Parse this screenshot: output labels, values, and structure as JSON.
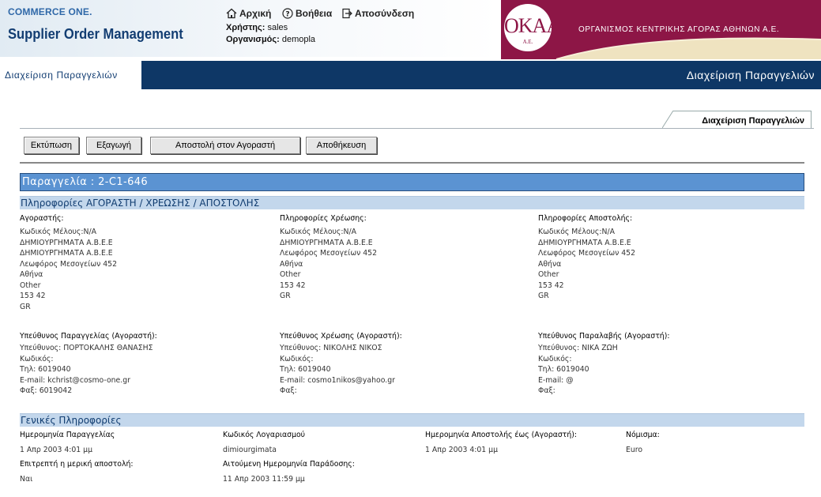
{
  "header": {
    "brand_small": "COMMERCE ONE.",
    "brand_big": "Supplier Order Management",
    "nav": {
      "home": "Αρχική",
      "help": "Βοήθεια",
      "logout": "Αποσύνδεση"
    },
    "user_label": "Χρήστης:",
    "user_value": "sales",
    "org_label": "Οργανισμός:",
    "org_value": "demopla",
    "org_logo_text": "ΟΚΑΑ",
    "org_logo_sub": "A.E.",
    "org_title": "ΟΡΓΑΝΙΣΜΟΣ ΚΕΝΤΡΙΚΗΣ ΑΓΟΡΑΣ ΑΘΗΝΩΝ Α.Ε.",
    "accent": "#8d1646"
  },
  "navbar": {
    "tab_label": "Διαχείριση Παραγγελιών",
    "right_title": "Διαχείριση Παραγγελιών",
    "color": "#0e3766"
  },
  "page_tab": "Διαχείριση Παραγγελιών",
  "toolbar": {
    "print": "Εκτύπωση",
    "export": "Εξαγωγή",
    "send": "Αποστολή στον Αγοραστή",
    "save": "Αποθήκευση"
  },
  "order": {
    "title": "Παραγγελία : 2-C1-646"
  },
  "section_parties": {
    "title": "Πληροφορίες ΑΓΟΡΑΣΤΗ / ΧΡΕΩΣΗΣ / ΑΠΟΣΤΟΛΗΣ",
    "columns": [
      {
        "heading": "Αγοραστής:",
        "lines": [
          "Κωδικός Μέλους:N/A",
          "ΔΗΜΙΟΥΡΓΗΜΑΤΑ Α.Β.Ε.Ε",
          "ΔΗΜΙΟΥΡΓΗΜΑΤΑ Α.Β.Ε.Ε",
          "Λεωφόρος Μεσογείων 452",
          "Αθήνα",
          "Other",
          "153 42",
          "GR"
        ],
        "contact_heading": "Υπεύθυνος Παραγγελίας (Αγοραστή):",
        "contact_lines": [
          "Υπεύθυνος: ΠΟΡΤΟΚΑΛΗΣ ΘΑΝΑΣΗΣ",
          "Κωδικός:",
          "Τηλ: 6019040",
          "E-mail: kchrist@cosmo-one.gr",
          "Φαξ: 6019042"
        ]
      },
      {
        "heading": "Πληροφορίες Χρέωσης:",
        "lines": [
          "Κωδικός Μέλους:N/A",
          "ΔΗΜΙΟΥΡΓΗΜΑΤΑ Α.Β.Ε.Ε",
          "Λεωφόρος Μεσογείων 452",
          "Αθήνα",
          "Other",
          "153 42",
          "GR"
        ],
        "contact_heading": "Υπεύθυνος Χρέωσης (Αγοραστή):",
        "contact_lines": [
          "Υπεύθυνος: ΝΙΚΟΛΗΣ ΝΙΚΟΣ",
          "Κωδικός:",
          "Τηλ: 6019040",
          "E-mail: cosmo1nikos@yahoo.gr",
          "Φαξ:"
        ]
      },
      {
        "heading": "Πληροφορίες Αποστολής:",
        "lines": [
          "Κωδικός Μέλους:N/A",
          "ΔΗΜΙΟΥΡΓΗΜΑΤΑ Α.Β.Ε.Ε",
          "Λεωφόρος Μεσογείων 452",
          "Αθήνα",
          "Other",
          "153 42",
          "GR"
        ],
        "contact_heading": "Υπεύθυνος Παραλαβής (Αγοραστή):",
        "contact_lines": [
          "Υπεύθυνος: ΝΙΚΑ ΖΩΗ",
          "Κωδικός:",
          "Τηλ: 6019040",
          "E-mail: @",
          "Φαξ:"
        ]
      }
    ]
  },
  "section_general": {
    "title": "Γενικές Πληροφορίες",
    "order_date_label": "Ημερομηνία Παραγγελίας",
    "order_date": "1 Απρ 2003 4:01 μμ",
    "account_label": "Κωδικός Λογαριασμού",
    "account": "dimiourgimata",
    "ship_by_label": "Ημερομηνία Αποστολής έως (Αγοραστή):",
    "ship_by": "1 Απρ 2003 4:01 μμ",
    "currency_label": "Νόμισμα:",
    "currency": "Euro",
    "partial_label": "Επιτρεπτή η μερική αποστολή:",
    "partial": "Ναι",
    "req_delivery_label": "Αιτούμενη Ημερομηνία Παράδοσης:",
    "req_delivery": "11 Απρ 2003 11:59 μμ"
  }
}
